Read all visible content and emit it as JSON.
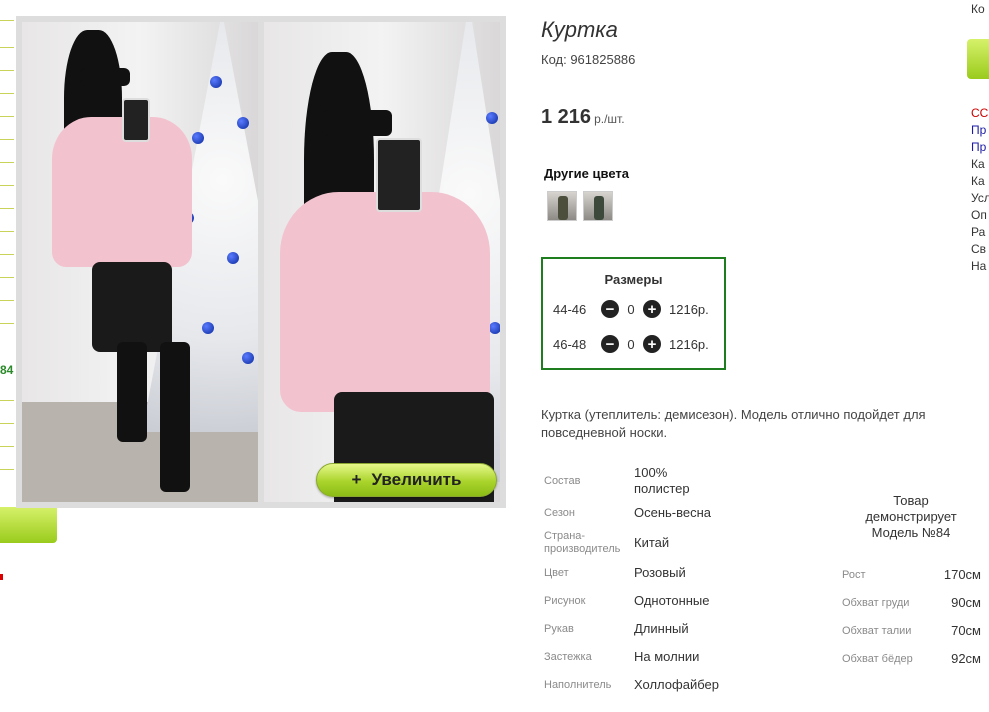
{
  "left": {
    "partial_number": "84"
  },
  "gallery": {
    "zoom_button_label": "Увеличить",
    "zoom_icon": "plus-icon"
  },
  "product": {
    "title": "Куртка",
    "code": "Код: 961825886",
    "price": "1 216",
    "price_unit": "р./шт.",
    "other_colors_title": "Другие цвета",
    "sizes_title": "Размеры",
    "sizes": [
      {
        "label": "44-46",
        "qty": "0",
        "price": "1216р."
      },
      {
        "label": "46-48",
        "qty": "0",
        "price": "1216р."
      }
    ],
    "description": "Куртка (утеплитель: демисезон). Модель отлично подойдет для повседневной носки."
  },
  "specs": [
    {
      "label": "Состав",
      "value": "100% полистер"
    },
    {
      "label": "Сезон",
      "value": "Осень-весна"
    },
    {
      "label": "Страна-производитель",
      "value": "Китай"
    },
    {
      "label": "Цвет",
      "value": "Розовый"
    },
    {
      "label": "Рисунок",
      "value": "Однотонные"
    },
    {
      "label": "Рукав",
      "value": "Длинный"
    },
    {
      "label": "Застежка",
      "value": "На молнии"
    },
    {
      "label": "Наполнитель",
      "value": "Холлофайбер"
    }
  ],
  "model": {
    "note": "Товар демонстрирует Модель №84",
    "measurements": [
      {
        "label": "Рост",
        "value": "170см"
      },
      {
        "label": "Обхват груди",
        "value": "90см"
      },
      {
        "label": "Обхват талии",
        "value": "70см"
      },
      {
        "label": "Обхват бёдер",
        "value": "92см"
      }
    ]
  },
  "right_sidebar": {
    "top_text": "Ко",
    "items": [
      {
        "text": "СС",
        "color": "#cc0000"
      },
      {
        "text": "Пр",
        "color": "#1a1aa6"
      },
      {
        "text": "Пр",
        "color": "#1a1aa6"
      },
      {
        "text": "Ка",
        "color": "#333333"
      },
      {
        "text": "Ка",
        "color": "#333333"
      },
      {
        "text": "Усл",
        "color": "#333333"
      },
      {
        "text": "Оп",
        "color": "#333333"
      },
      {
        "text": "Ра",
        "color": "#333333"
      },
      {
        "text": "Св",
        "color": "#333333"
      },
      {
        "text": "На",
        "color": "#333333"
      }
    ]
  },
  "colors": {
    "accent_green": "#1e7d1e",
    "button_green": "#a9d42b"
  }
}
